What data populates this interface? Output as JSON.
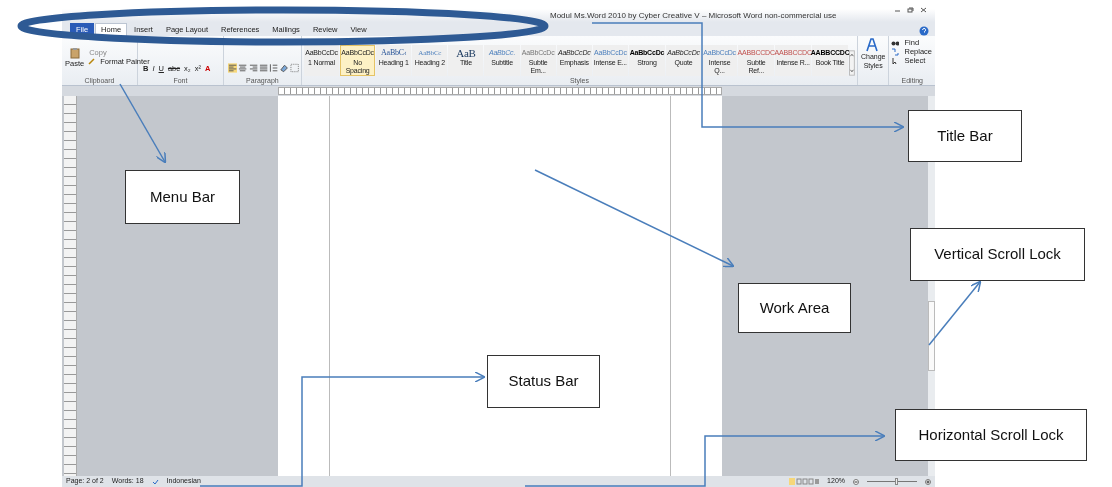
{
  "window": {
    "title": "Modul Ms.Word 2010 by Cyber Creative V – Microsoft Word non-commercial use"
  },
  "tabs": [
    {
      "label": "File",
      "kind": "file",
      "selected": false
    },
    {
      "label": "Home",
      "kind": "tab",
      "selected": true
    },
    {
      "label": "Insert",
      "kind": "tab",
      "selected": false
    },
    {
      "label": "Page Layout",
      "kind": "tab",
      "selected": false
    },
    {
      "label": "References",
      "kind": "tab",
      "selected": false
    },
    {
      "label": "Mailings",
      "kind": "tab",
      "selected": false
    },
    {
      "label": "Review",
      "kind": "tab",
      "selected": false
    },
    {
      "label": "View",
      "kind": "tab",
      "selected": false
    }
  ],
  "ribbon": {
    "clipboard": {
      "paste": "Paste",
      "copy": "Copy",
      "format_painter": "Format Painter",
      "label": "Clipboard"
    },
    "font": {
      "buttons": [
        "B",
        "I",
        "U",
        "abc",
        "x₂",
        "x²",
        "A"
      ],
      "label": "Font"
    },
    "paragraph": {
      "label": "Paragraph"
    },
    "styles": {
      "label": "Styles",
      "items": [
        {
          "sample": "AaBbCcDc",
          "name": "1 Normal",
          "selected": false
        },
        {
          "sample": "AaBbCcDc",
          "name": "No Spacing",
          "selected": true
        },
        {
          "sample": "AaBbC‹",
          "name": "Heading 1",
          "selected": false
        },
        {
          "sample": "AaBbCc",
          "name": "Heading 2",
          "selected": false
        },
        {
          "sample": "AaB",
          "name": "Title",
          "selected": false
        },
        {
          "sample": "AaBbCc.",
          "name": "Subtitle",
          "selected": false
        },
        {
          "sample": "AaBbCcDc",
          "name": "Subtle Em...",
          "selected": false
        },
        {
          "sample": "AaBbCcDc",
          "name": "Emphasis",
          "selected": false
        },
        {
          "sample": "AaBbCcDc",
          "name": "Intense E...",
          "selected": false
        },
        {
          "sample": "AaBbCcDc",
          "name": "Strong",
          "selected": false
        },
        {
          "sample": "AaBbCcDc",
          "name": "Quote",
          "selected": false
        },
        {
          "sample": "AaBbCcDc",
          "name": "Intense Q...",
          "selected": false
        },
        {
          "sample": "AABBCCDC",
          "name": "Subtle Ref...",
          "selected": false
        },
        {
          "sample": "AABBCCDC",
          "name": "Intense R...",
          "selected": false
        },
        {
          "sample": "AABBCCDC",
          "name": "Book Title",
          "selected": false
        }
      ]
    },
    "change_styles": "Change Styles",
    "editing": {
      "label": "Editing",
      "items": [
        "Find",
        "Replace",
        "Select"
      ]
    }
  },
  "status_bar": {
    "page": "Page: 2 of 2",
    "words": "Words: 18",
    "language": "Indonesian",
    "zoom": "120%",
    "zoom_slider": {
      "level": 0.55
    }
  },
  "callouts": [
    {
      "label": "Title Bar"
    },
    {
      "label": "Menu Bar"
    },
    {
      "label": "Vertical Scroll Lock"
    },
    {
      "label": "Work Area"
    },
    {
      "label": "Status Bar"
    },
    {
      "label": "Horizontal Scroll Lock"
    }
  ]
}
